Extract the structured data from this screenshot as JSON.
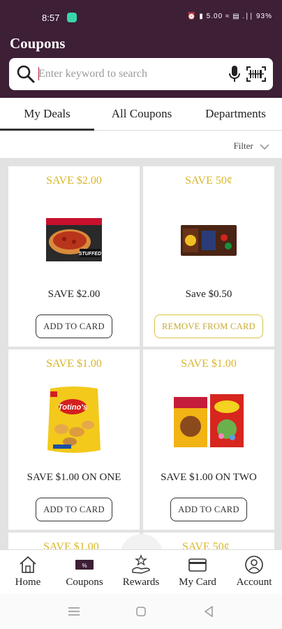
{
  "status_bar": {
    "time": "8:57",
    "indicators": "⏰ ▮ 5.00 ≈ ▤ .∣∣ 93%"
  },
  "header": {
    "title": "Coupons"
  },
  "search": {
    "placeholder": "Enter keyword to search"
  },
  "tabs": [
    {
      "label": "My Deals",
      "active": true
    },
    {
      "label": "All Coupons",
      "active": false
    },
    {
      "label": "Departments",
      "active": false
    }
  ],
  "filter": {
    "label": "Filter"
  },
  "coupons": [
    {
      "headline": "SAVE $2.00",
      "description": "SAVE $2.00",
      "action": "ADD TO CARD",
      "product_icon": "stuffed-crust-pizza-box"
    },
    {
      "headline": "SAVE 50¢",
      "description": "Save $0.50",
      "action": "REMOVE FROM CARD",
      "product_icon": "mms-candy-bag"
    },
    {
      "headline": "SAVE $1.00",
      "description": "SAVE $1.00 ON ONE",
      "action": "ADD TO CARD",
      "product_icon": "totinos-pizza-rolls-bag"
    },
    {
      "headline": "SAVE $1.00",
      "description": "SAVE $1.00 ON TWO",
      "action": "ADD TO CARD",
      "product_icon": "cereal-boxes"
    },
    {
      "headline": "SAVE $1.00"
    },
    {
      "headline": "SAVE 50¢"
    }
  ],
  "bottom_nav": [
    {
      "label": "Home",
      "icon": "home-icon"
    },
    {
      "label": "Coupons",
      "icon": "coupon-icon"
    },
    {
      "label": "Rewards",
      "icon": "rewards-icon"
    },
    {
      "label": "My Card",
      "icon": "card-icon"
    },
    {
      "label": "Account",
      "icon": "account-icon"
    }
  ],
  "colors": {
    "header_bg": "#3d1f36",
    "accent_gold": "#d9b627",
    "grid_bg": "#e2e2e2"
  }
}
